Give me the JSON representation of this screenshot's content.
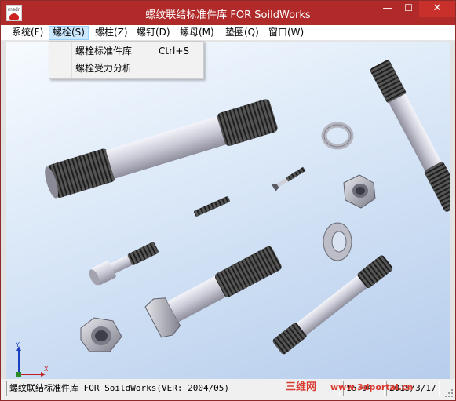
{
  "window": {
    "title": "螺纹联结标准件库 FOR SoildWorks",
    "icon_text": "msdn",
    "controls": {
      "minimize": "—",
      "maximize": "☐",
      "close": "✕"
    }
  },
  "menubar": {
    "items": [
      {
        "label": "系统(F)"
      },
      {
        "label": "螺栓(S)"
      },
      {
        "label": "螺柱(Z)"
      },
      {
        "label": "螺钉(D)"
      },
      {
        "label": "螺母(M)"
      },
      {
        "label": "垫圈(Q)"
      },
      {
        "label": "窗口(W)"
      }
    ]
  },
  "dropdown": {
    "items": [
      {
        "label": "螺栓标准件库",
        "shortcut": "Ctrl+S"
      },
      {
        "label": "螺栓受力分析",
        "shortcut": ""
      }
    ]
  },
  "viewport": {
    "axis_labels": {
      "y": "Y",
      "x": "X"
    },
    "colors": {
      "thread": "#3a3a3a",
      "shank": "#d0d0da",
      "nut": "#a9a9b4"
    }
  },
  "statusbar": {
    "message": "螺纹联结标准件库 FOR SoildWorks(VER: 2004/05)",
    "time": "16:04",
    "date": "2015/3/17",
    "watermark_cn": "三维网",
    "watermark_url": "www.3dportal.cn"
  }
}
